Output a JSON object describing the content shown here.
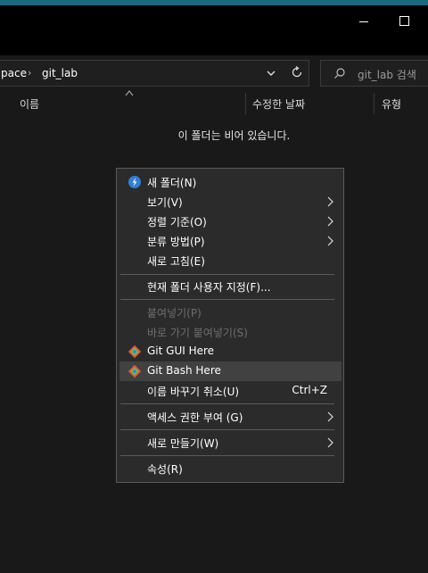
{
  "window": {
    "minimize_icon": "minimize-icon",
    "maximize_icon": "maximize-icon"
  },
  "address": {
    "crumbs": [
      "pace",
      "git_lab"
    ],
    "separator": "›"
  },
  "search": {
    "placeholder": "git_lab 검색"
  },
  "columns": {
    "name": "이름",
    "date_modified": "수정한 날짜",
    "type": "유형"
  },
  "empty_message": "이 폴더는 비어 있습니다.",
  "context_menu": {
    "new_folder": "새 폴더(N)",
    "view": "보기(V)",
    "sort_by": "정렬 기준(O)",
    "group_by": "분류 방법(P)",
    "refresh": "새로 고침(E)",
    "customize": "현재 폴더 사용자 지정(F)...",
    "paste": "붙여넣기(P)",
    "paste_shortcut": "바로 가기 붙여넣기(S)",
    "git_gui": "Git GUI Here",
    "git_bash": "Git Bash Here",
    "undo_rename": "이름 바꾸기 취소(U)",
    "undo_rename_shortcut": "Ctrl+Z",
    "give_access": "액세스 권한 부여 (G)",
    "new": "새로 만들기(W)",
    "properties": "속성(R)"
  },
  "colors": {
    "accent": "#1a6a7d",
    "background": "#191919",
    "menu_bg": "#2b2b2b",
    "menu_highlight": "#414141",
    "git_orange": "#f05133"
  }
}
